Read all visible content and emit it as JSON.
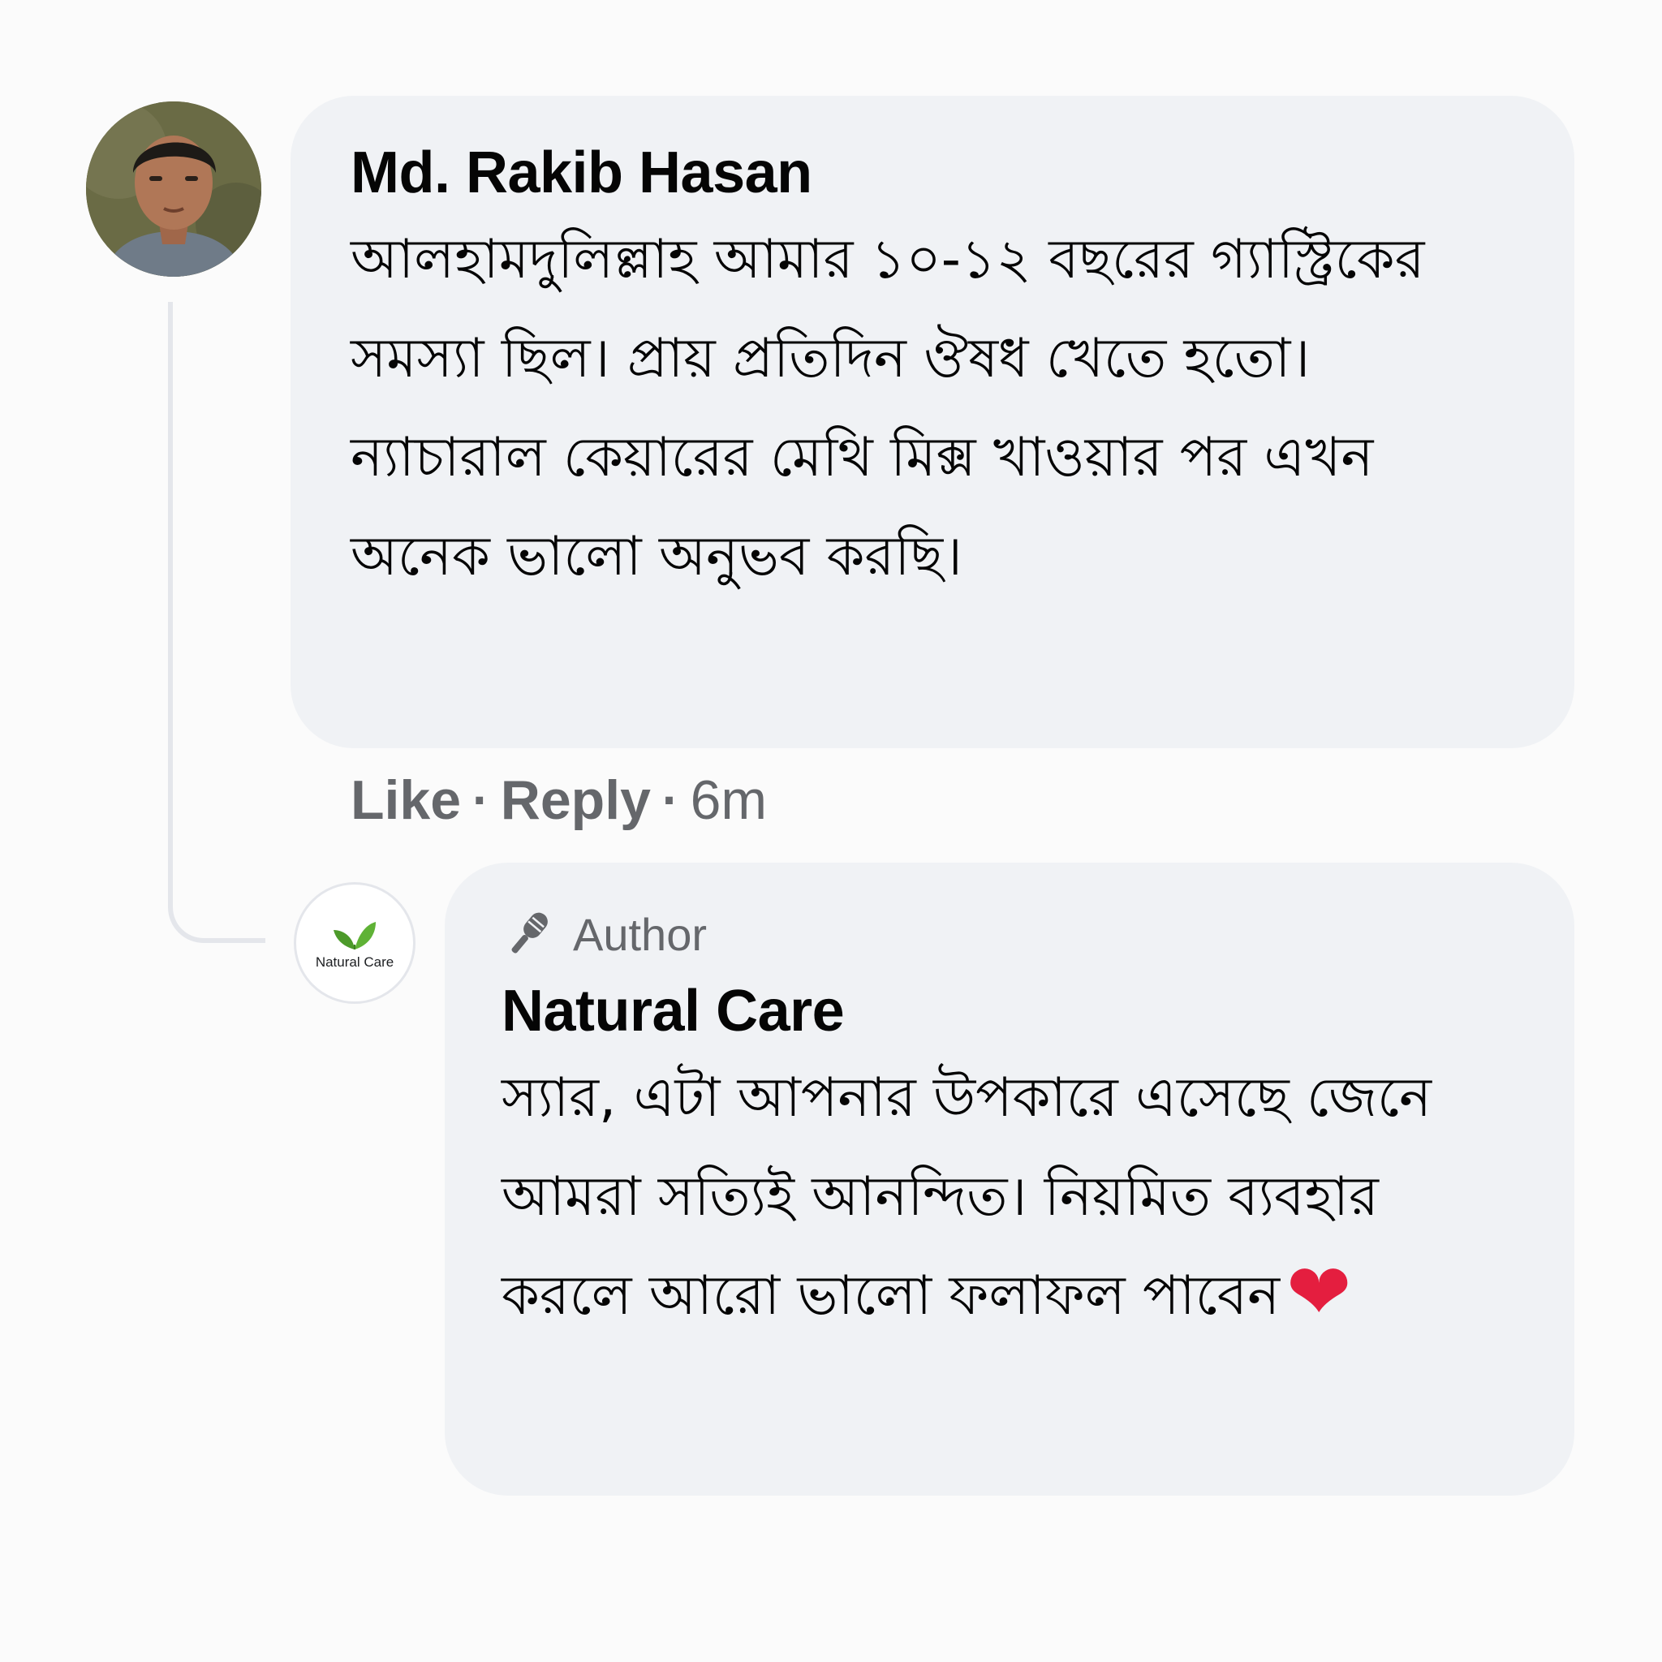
{
  "thread": {
    "comment": {
      "author": "Md. Rakib Hasan",
      "text": "আলহামদুলিল্লাহ আমার ১০-১২ বছরের গ্যাস্ট্রিকের সমস্যা ছিল। প্রায় প্রতিদিন ঔষধ খেতে হতো। ন্যাচারাল কেয়ারের মেথি মিক্স খাওয়ার পর এখন অনেক ভালো অনুভব করছি।",
      "actions": {
        "like": "Like",
        "reply": "Reply",
        "separator": "·",
        "time": "6m"
      }
    },
    "reply": {
      "badge_icon": "microphone-icon",
      "badge_label": "Author",
      "author": "Natural Care",
      "avatar_logo_text": "Natural Care",
      "text": "স্যার, এটা আপনার উপকারে এসেছে জেনে আমরা সত্যিই আনন্দিত। নিয়মিত ব্যবহার করলে আরো ভালো ফলাফল পাবেন",
      "emoji": "❤"
    }
  },
  "colors": {
    "bubble_bg": "#f0f2f5",
    "meta_text": "#65676b",
    "primary_text": "#050505",
    "leaf_green": "#4c9a2a",
    "heart_red": "#e41e3f",
    "thread_line": "#e4e6eb"
  }
}
